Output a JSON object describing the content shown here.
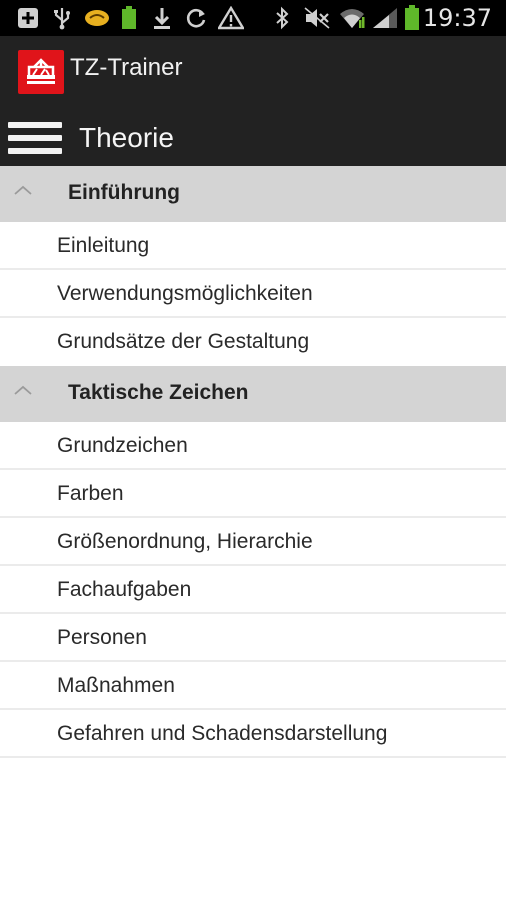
{
  "status_bar": {
    "time": "19:37",
    "left_icons": [
      "add-box-icon",
      "usb-icon",
      "mail-icon",
      "battery-notification-icon",
      "download-icon",
      "sync-icon",
      "warning-icon"
    ],
    "right_icons": [
      "bluetooth-icon",
      "mute-icon",
      "wifi-icon",
      "signal-icon",
      "battery-icon"
    ]
  },
  "app": {
    "title": "TZ-Trainer",
    "brand_color": "#e0141a"
  },
  "toolbar": {
    "screen_title": "Theorie"
  },
  "sections": [
    {
      "title": "Einführung",
      "expanded": true,
      "items": [
        "Einleitung",
        "Verwendungsmöglichkeiten",
        "Grundsätze der Gestaltung"
      ]
    },
    {
      "title": "Taktische Zeichen",
      "expanded": true,
      "items": [
        "Grundzeichen",
        "Farben",
        "Größenordnung, Hierarchie",
        "Fachaufgaben",
        "Personen",
        "Maßnahmen",
        "Gefahren und Schadensdarstellung"
      ]
    }
  ]
}
